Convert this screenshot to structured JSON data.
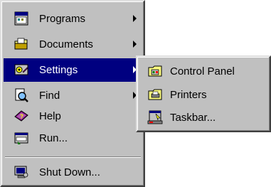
{
  "start_menu": {
    "items": [
      {
        "label": "Programs",
        "icon": "programs-icon",
        "submenu": true
      },
      {
        "label": "Documents",
        "icon": "documents-icon",
        "submenu": true
      },
      {
        "label": "Settings",
        "icon": "settings-icon",
        "submenu": true,
        "highlighted": true
      },
      {
        "label": "Find",
        "icon": "find-icon",
        "submenu": true
      },
      {
        "label": "Help",
        "icon": "help-icon",
        "submenu": false
      },
      {
        "label": "Run...",
        "icon": "run-icon",
        "submenu": false
      },
      {
        "label": "Shut Down...",
        "icon": "shut-down-icon",
        "submenu": false
      }
    ]
  },
  "settings_submenu": {
    "items": [
      {
        "label": "Control Panel",
        "icon": "control-panel-icon"
      },
      {
        "label": "Printers",
        "icon": "printers-icon"
      },
      {
        "label": "Taskbar...",
        "icon": "taskbar-icon"
      }
    ]
  },
  "colors": {
    "menu_face": "#c0c0c0",
    "highlight": "#000080",
    "highlight_text": "#ffffff"
  }
}
